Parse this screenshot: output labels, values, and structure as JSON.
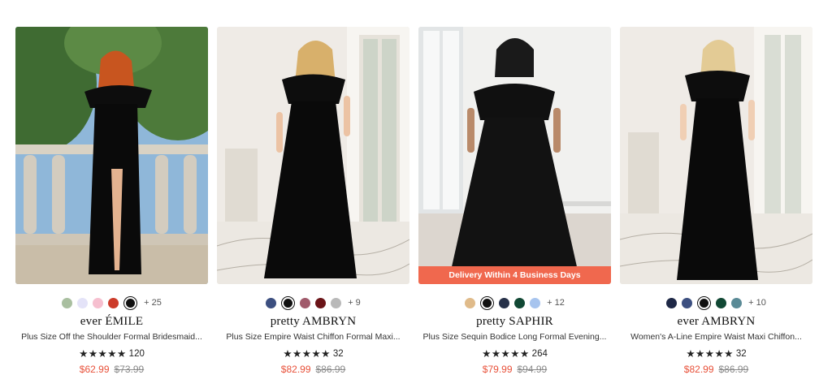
{
  "products": [
    {
      "swatches": [
        "#a9bfa0",
        "#e4e3f8",
        "#f6bfcf",
        "#cc3b2a",
        "#111111"
      ],
      "selected": 4,
      "more": "+ 25",
      "brand": "ever ÉMILE",
      "title": "Plus Size Off the Shoulder Formal Bridesmaid...",
      "stars": "★★★★★",
      "reviews": "120",
      "price": "$62.99",
      "old_price": "$73.99",
      "banner": ""
    },
    {
      "swatches": [
        "#3c4f80",
        "#111111",
        "#a05a6b",
        "#6b1418",
        "#b9b9b9"
      ],
      "selected": 1,
      "more": "+ 9",
      "brand": "pretty AMBRYN",
      "title": "Plus Size Empire Waist Chiffon Formal Maxi...",
      "stars": "★★★★★",
      "reviews": "32",
      "price": "$82.99",
      "old_price": "$86.99",
      "banner": ""
    },
    {
      "swatches": [
        "#e0bb8a",
        "#111111",
        "#273149",
        "#114834",
        "#a7c4ee"
      ],
      "selected": 1,
      "more": "+ 12",
      "brand": "pretty SAPHIR",
      "title": "Plus Size Sequin Bodice Long Formal Evening...",
      "stars": "★★★★★",
      "reviews": "264",
      "price": "$79.99",
      "old_price": "$94.99",
      "banner": "Delivery Within 4 Business Days"
    },
    {
      "swatches": [
        "#1e2846",
        "#3c4f80",
        "#111111",
        "#114834",
        "#5a8a96"
      ],
      "selected": 2,
      "more": "+ 10",
      "brand": "ever AMBRYN",
      "title": "Women's A-Line Empire Waist Maxi Chiffon...",
      "stars": "★★★★★",
      "reviews": "32",
      "price": "$82.99",
      "old_price": "$86.99",
      "banner": ""
    }
  ]
}
